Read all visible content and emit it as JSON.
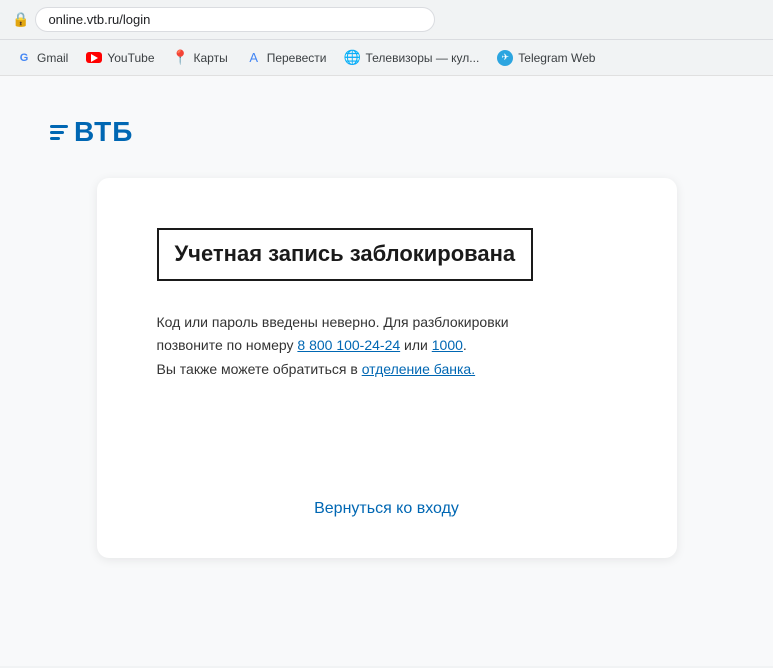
{
  "browser": {
    "url": "online.vtb.ru/login",
    "lock_icon": "🔒"
  },
  "bookmarks": [
    {
      "id": "gmail",
      "label": "Gmail",
      "icon_type": "gmail"
    },
    {
      "id": "youtube",
      "label": "YouTube",
      "icon_type": "youtube"
    },
    {
      "id": "maps",
      "label": "Карты",
      "icon_type": "maps"
    },
    {
      "id": "translate",
      "label": "Перевести",
      "icon_type": "translate"
    },
    {
      "id": "tvs",
      "label": "Телевизоры — кул...",
      "icon_type": "globe"
    },
    {
      "id": "telegram",
      "label": "Telegram Web",
      "icon_type": "telegram"
    }
  ],
  "logo": {
    "text": "ВТБ"
  },
  "card": {
    "title": "Учетная запись заблокирована",
    "body_line1": "Код или пароль введены неверно. Для разблокировки",
    "body_line2": "позвоните по номеру ",
    "phone1": "8 800 100-24-24",
    "body_or": " или ",
    "phone2": "1000",
    "body_line3_prefix": "Вы также можете обратиться в ",
    "branch_link": "отделение банка.",
    "back_link": "Вернуться ко входу"
  }
}
